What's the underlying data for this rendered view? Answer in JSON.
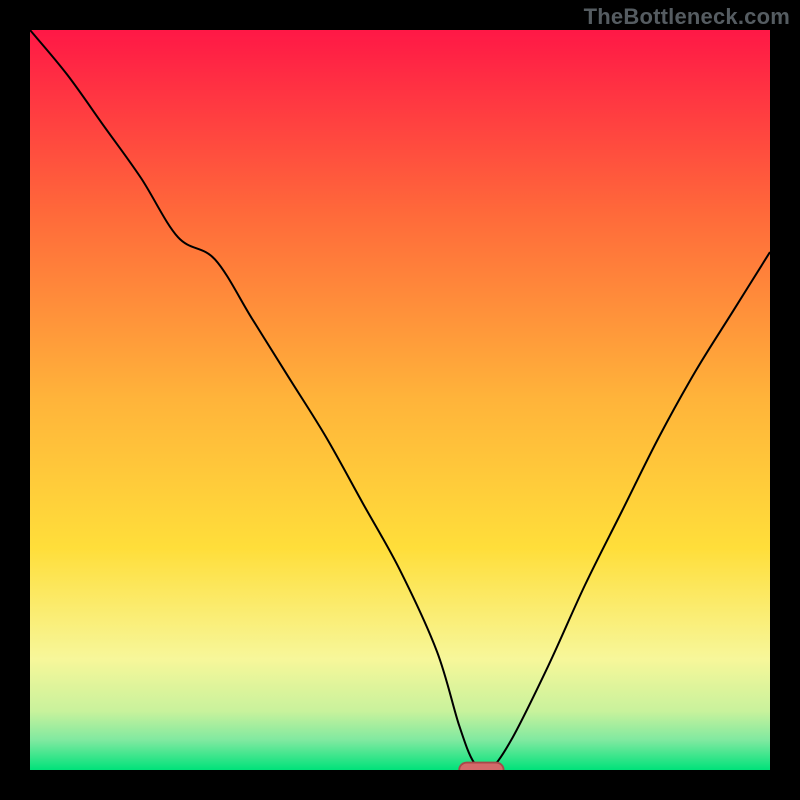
{
  "watermark": "TheBottleneck.com",
  "chart_data": {
    "type": "line",
    "title": "",
    "xlabel": "",
    "ylabel": "",
    "xlim": [
      0,
      100
    ],
    "ylim": [
      0,
      100
    ],
    "grid": false,
    "colors": {
      "top": "#ff1846",
      "mid": "#ffd700",
      "bottom": "#00e27a",
      "curve": "#000000",
      "marker_fill": "#d46a6a",
      "marker_stroke": "#a74a4a",
      "frame": "#000000"
    },
    "gradient_stops": [
      {
        "at": 0,
        "hex": "#ff1846"
      },
      {
        "at": 25,
        "hex": "#ff6a3a"
      },
      {
        "at": 50,
        "hex": "#ffb43a"
      },
      {
        "at": 70,
        "hex": "#ffde3a"
      },
      {
        "at": 85,
        "hex": "#f7f79a"
      },
      {
        "at": 92,
        "hex": "#c9f29c"
      },
      {
        "at": 96,
        "hex": "#7fe9a0"
      },
      {
        "at": 100,
        "hex": "#00e27a"
      }
    ],
    "curve": {
      "comment": "V-shaped bottleneck curve. y = estimated bottleneck percentage (0 good, 100 bad). x runs left→right across the plot area. Values read off the figure by height.",
      "x": [
        0,
        5,
        10,
        15,
        20,
        25,
        30,
        35,
        40,
        45,
        50,
        55,
        58,
        60,
        62,
        65,
        70,
        75,
        80,
        85,
        90,
        95,
        100
      ],
      "y": [
        100,
        94,
        87,
        80,
        72,
        69,
        61,
        53,
        45,
        36,
        27,
        16,
        6,
        1,
        0,
        4,
        14,
        25,
        35,
        45,
        54,
        62,
        70
      ]
    },
    "optimum": {
      "comment": "Highlighted minimum point at the bottom of the V.",
      "x": 61,
      "y": 0,
      "shape": "pill",
      "width": 6,
      "height": 2
    }
  }
}
